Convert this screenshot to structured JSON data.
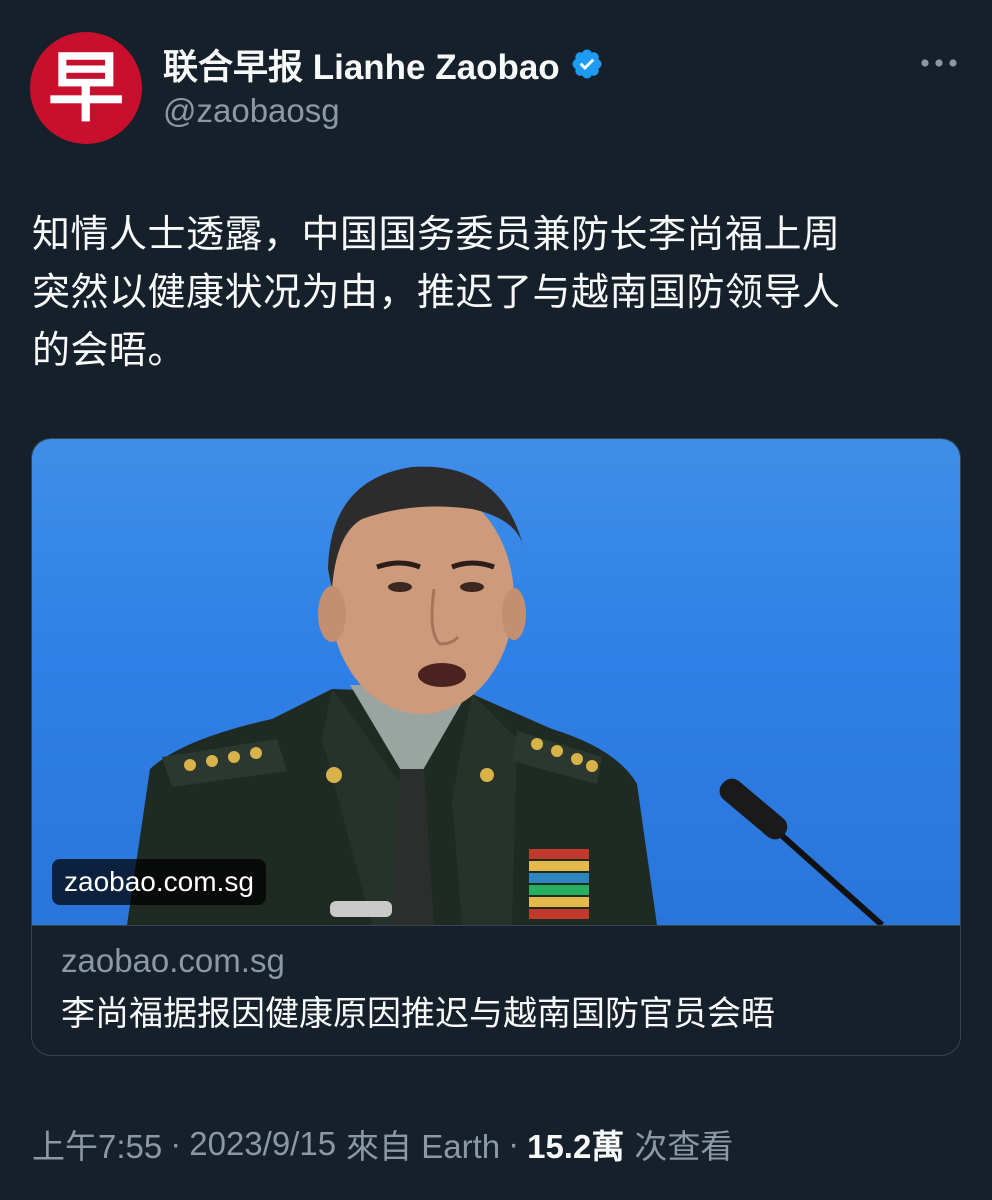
{
  "account": {
    "avatar_glyph": "早",
    "avatar_color": "#c8102e",
    "display_name": "联合早报 Lianhe Zaobao",
    "handle": "@zaobaosg",
    "verified_icon": "verified-badge-icon",
    "verified_color": "#1d9bf0"
  },
  "more_icon": "more-options-icon",
  "tweet": {
    "text": "知情人士透露，中国国务委员兼防长李尚福上周\n突然以健康状况为由，推迟了与越南国防领导人\n的会晤。"
  },
  "card": {
    "image_overlay_domain": "zaobao.com.sg",
    "domain": "zaobao.com.sg",
    "title": "李尚福据报因健康原因推迟与越南国防官员会晤"
  },
  "meta": {
    "time": "上午7:55",
    "separator": "·",
    "date": "2023/9/15",
    "source": "來自 Earth",
    "views_count": "15.2萬",
    "views_label": "次查看"
  },
  "colors": {
    "background": "#15202b",
    "text_primary": "#f7f9f9",
    "text_secondary": "#8b98a5",
    "border": "#38444d"
  }
}
